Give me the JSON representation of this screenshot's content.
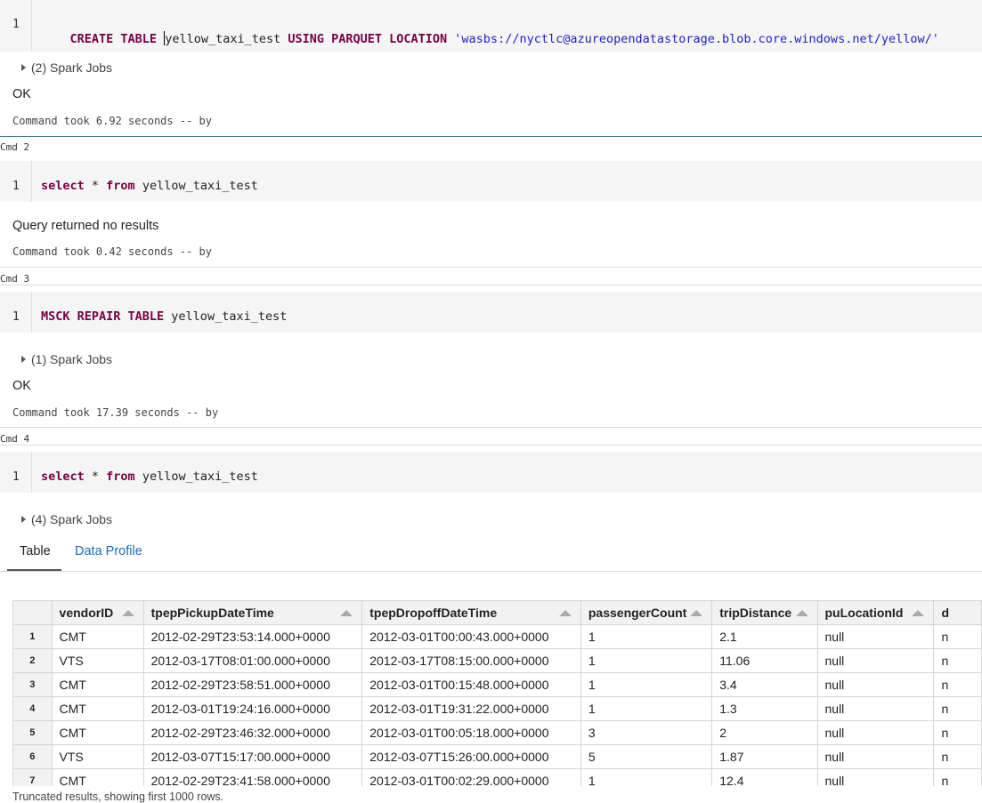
{
  "cells": [
    {
      "line_number": "1",
      "code_tokens": [
        {
          "t": "CREATE TABLE ",
          "k": "kw"
        },
        {
          "t": "yellow_taxi_test ",
          "k": ""
        },
        {
          "t": "USING PARQUET LOCATION ",
          "k": "kw"
        },
        {
          "t": "'wasbs://nyctlc@azureopendatastorage.blob.core.windows.net/yellow/'",
          "k": "str"
        }
      ],
      "spark_jobs": "(2) Spark Jobs",
      "result": "OK",
      "took": "Command took 6.92 seconds -- by"
    },
    {
      "cmd_label": "Cmd 2",
      "line_number": "1",
      "code_tokens": [
        {
          "t": "select",
          "k": "kw"
        },
        {
          "t": " * ",
          "k": ""
        },
        {
          "t": "from",
          "k": "kw"
        },
        {
          "t": " yellow_taxi_test",
          "k": ""
        }
      ],
      "result": "Query returned no results",
      "took": "Command took 0.42 seconds -- by"
    },
    {
      "cmd_label": "Cmd 3",
      "line_number": "1",
      "code_tokens": [
        {
          "t": "MSCK REPAIR TABLE",
          "k": "kw"
        },
        {
          "t": " yellow_taxi_test",
          "k": ""
        }
      ],
      "spark_jobs": "(1) Spark Jobs",
      "result": "OK",
      "took": "Command took 17.39 seconds -- by"
    },
    {
      "cmd_label": "Cmd 4",
      "line_number": "1",
      "code_tokens": [
        {
          "t": "select",
          "k": "kw"
        },
        {
          "t": " * ",
          "k": ""
        },
        {
          "t": "from",
          "k": "kw"
        },
        {
          "t": " yellow_taxi_test",
          "k": ""
        }
      ],
      "spark_jobs": "(4) Spark Jobs"
    }
  ],
  "result_tabs": {
    "table": "Table",
    "data_profile": "Data Profile",
    "active": "Table",
    "link_color": "#1a6db3"
  },
  "table": {
    "columns": [
      "vendorID",
      "tpepPickupDateTime",
      "tpepDropoffDateTime",
      "passengerCount",
      "tripDistance",
      "puLocationId",
      "d"
    ],
    "rows": [
      [
        "1",
        "CMT",
        "2012-02-29T23:53:14.000+0000",
        "2012-03-01T00:00:43.000+0000",
        "1",
        "2.1",
        "null",
        "n"
      ],
      [
        "2",
        "VTS",
        "2012-03-17T08:01:00.000+0000",
        "2012-03-17T08:15:00.000+0000",
        "1",
        "11.06",
        "null",
        "n"
      ],
      [
        "3",
        "CMT",
        "2012-02-29T23:58:51.000+0000",
        "2012-03-01T00:15:48.000+0000",
        "1",
        "3.4",
        "null",
        "n"
      ],
      [
        "4",
        "CMT",
        "2012-03-01T19:24:16.000+0000",
        "2012-03-01T19:31:22.000+0000",
        "1",
        "1.3",
        "null",
        "n"
      ],
      [
        "5",
        "CMT",
        "2012-02-29T23:46:32.000+0000",
        "2012-03-01T00:05:18.000+0000",
        "3",
        "2",
        "null",
        "n"
      ],
      [
        "6",
        "VTS",
        "2012-03-07T15:17:00.000+0000",
        "2012-03-07T15:26:00.000+0000",
        "5",
        "1.87",
        "null",
        "n"
      ],
      [
        "7",
        "CMT",
        "2012-02-29T23:41:58.000+0000",
        "2012-03-01T00:02:29.000+0000",
        "1",
        "12.4",
        "null",
        "n"
      ]
    ]
  },
  "truncated_note": "Truncated results, showing first 1000 rows.",
  "colors": {
    "keyword": "#770044",
    "string": "#2020c8",
    "code_bg": "#f5f5f5",
    "active_cell_border": "#4a7a99"
  }
}
